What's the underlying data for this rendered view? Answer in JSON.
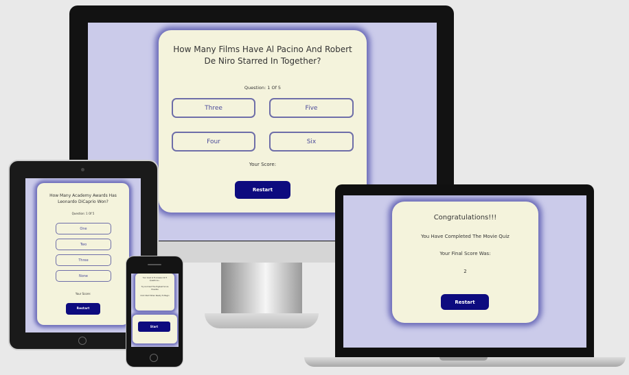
{
  "desktop": {
    "question": "How Many Films Have Al Pacino And Robert De Niro Starred In Together?",
    "progress": "Question: 1 Of 5",
    "options": [
      "Three",
      "Five",
      "Four",
      "Six"
    ],
    "score_label": "Your Score:",
    "restart_label": "Restart"
  },
  "tablet": {
    "question": "How Many Academy Awards Has Leonardo DiCaprio Won?",
    "progress": "Question: 1 Of 5",
    "options": [
      "One",
      "Two",
      "Three",
      "None"
    ],
    "score_label": "Your Score:",
    "restart_label": "Restart"
  },
  "laptop": {
    "heading": "Congratulations!!!",
    "message": "You Have Completed The Movie Quiz",
    "final_label": "Your Final Score Was:",
    "final_score": "2",
    "restart_label": "Restart"
  },
  "phone": {
    "lines": [
      "Your Goal Is To Answer All 5 Questions...",
      "Try And Get The Highest Score Possible",
      "Click Start When Ready To Begin"
    ],
    "start_label": "Start"
  },
  "colors": {
    "accent": "#0d0b7f",
    "card": "#f4f3dc",
    "screen": "#cbcbea",
    "glow": "#6a6ab8"
  }
}
